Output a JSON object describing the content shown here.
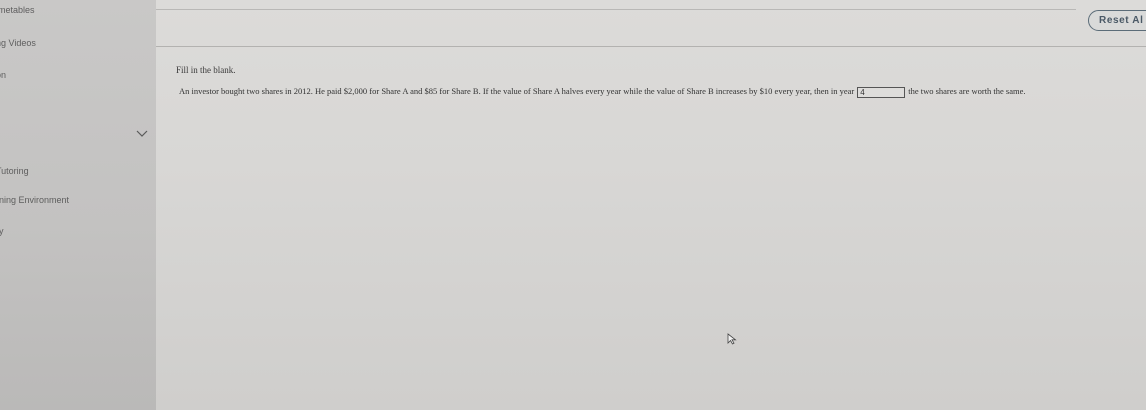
{
  "sidebar": {
    "items": [
      {
        "label": "imetables"
      },
      {
        "label": "ng Videos"
      },
      {
        "label": "on"
      },
      {
        "label": "Tutoring"
      },
      {
        "label": "rning Environment"
      },
      {
        "label": "ry"
      }
    ]
  },
  "toolbar": {
    "reset_label": "Reset Al"
  },
  "question": {
    "instruction": "Fill in the blank.",
    "text_before": "An investor bought two shares in 2012. He paid $2,000 for Share A and $85 for Share B. If the value of Share A halves every year while the value of Share B increases by $10 every year, then in year",
    "answer_value": "4",
    "text_after": "the two shares are worth the same."
  },
  "icons": {
    "expand": "chevron-down-icon",
    "pointer": "mouse-cursor-icon"
  },
  "colors": {
    "accent": "#4a5966",
    "sidebar_bg": "#c6c5c4",
    "main_bg": "#d9d8d6"
  }
}
